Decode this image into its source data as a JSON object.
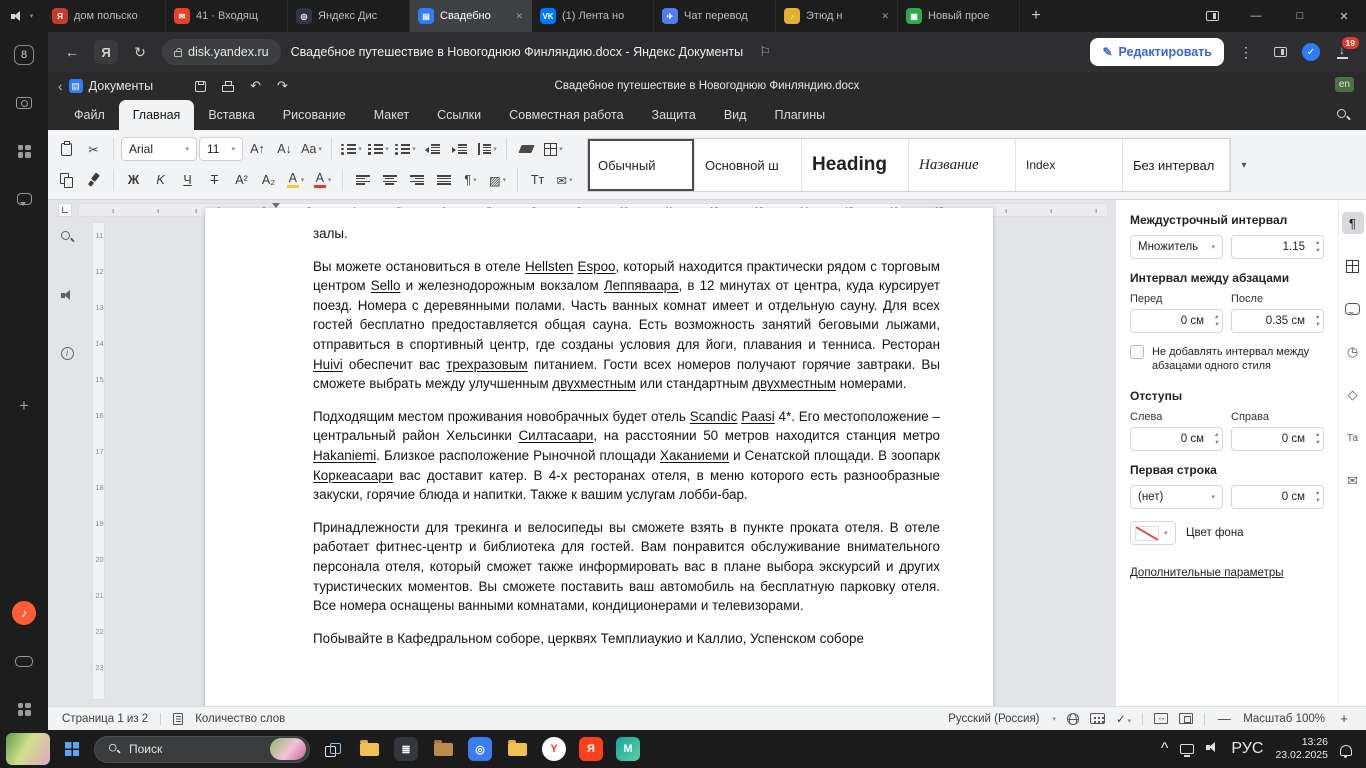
{
  "icons": {
    "chevron_down": "▾",
    "chevron_left": "‹",
    "back": "←",
    "reload": "↻",
    "undo": "↶",
    "redo": "↷",
    "close": "✕",
    "minimize": "—",
    "maximize": "□",
    "plus": "+",
    "scissors": "✂",
    "kebab": "⋮",
    "check": "✓",
    "paragraph": "¶",
    "envelope": "✉",
    "flag": "⚐",
    "pencil": "✎",
    "info": "i",
    "ya": "Я",
    "caret_up": "^",
    "shade": "▨",
    "music": "♪",
    "clock": "◷",
    "shapes": "◇",
    "translate": "Та",
    "down_arrow": "↓",
    "spin_up": "▴",
    "spin_down": "▾",
    "tt": "Тт"
  },
  "browser": {
    "tabs": [
      {
        "label": "дом польско",
        "glyph": "Я",
        "color": "#c43c2e"
      },
      {
        "label": "41 · Входящ",
        "glyph": "✉",
        "color": "#e8402a"
      },
      {
        "label": "Яндекс Дис",
        "glyph": "◎",
        "color": "#2f3640"
      },
      {
        "label": "Свадебно",
        "glyph": "▤",
        "color": "#2f7df6",
        "active": true,
        "close": true
      },
      {
        "label": "(1) Лента но",
        "glyph": "VK",
        "color": "#0077ff"
      },
      {
        "label": "Чат перевод",
        "glyph": "✈",
        "color": "#4f7df0"
      },
      {
        "label": "Этюд н",
        "glyph": "♪",
        "color": "#e9b02c",
        "close": true
      },
      {
        "label": "Новый прое",
        "glyph": "▦",
        "color": "#2fa84f"
      }
    ],
    "address": {
      "domain": "disk.yandex.ru",
      "title": "Свадебное путешествие в Новогоднюю Финляндию.docx - Яндекс Документы",
      "edit_button": "Редактировать",
      "downloads_badge": "19"
    },
    "sidebar": {
      "tabs_count": "8"
    }
  },
  "app": {
    "header": {
      "back_label": "Документы",
      "title": "Свадебное путешествие в Новогоднюю Финляндию.docx",
      "lang_badge": "en"
    },
    "menu": [
      "Файл",
      "Главная",
      "Вставка",
      "Рисование",
      "Макет",
      "Ссылки",
      "Совместная работа",
      "Защита",
      "Вид",
      "Плагины"
    ],
    "active_menu_index": 1,
    "toolbar": {
      "font": "Arial",
      "size": "11",
      "bold": "Ж",
      "italic": "K",
      "underline": "Ч",
      "strike": "Т",
      "superscript": "A²",
      "subscript": "A₂",
      "font_up": "A↑",
      "font_down": "A↓",
      "case": "Aa",
      "color_letter": "А",
      "styles": [
        {
          "label": "Обычный",
          "cls": "normal",
          "selected": true
        },
        {
          "label": "Основной ш",
          "cls": "basic"
        },
        {
          "label": "Heading",
          "cls": "heading"
        },
        {
          "label": "Название",
          "cls": "title"
        },
        {
          "label": "Index",
          "cls": "index"
        },
        {
          "label": "Без интервал",
          "cls": "nospace"
        }
      ]
    }
  },
  "rulers": {
    "h": [
      1,
      2,
      3,
      4,
      5,
      6,
      7,
      8,
      9,
      10,
      11,
      12,
      13,
      14,
      15,
      16,
      17
    ],
    "v": [
      11,
      12,
      13,
      14,
      15,
      16,
      17,
      18,
      19,
      20,
      21,
      22,
      23
    ]
  },
  "document": {
    "paragraphs": [
      {
        "runs": [
          {
            "t": "залы."
          }
        ]
      },
      {
        "runs": [
          {
            "t": "Вы можете остановиться в отеле "
          },
          {
            "t": "Hellsten",
            "u": true
          },
          {
            "t": " "
          },
          {
            "t": "Espoo",
            "u": true
          },
          {
            "t": ", который находится практически рядом с торговым центром "
          },
          {
            "t": "Sello",
            "u": true
          },
          {
            "t": " и железнодорожным вокзалом "
          },
          {
            "t": "Леппяваара",
            "u": true
          },
          {
            "t": ", в 12 минутах от центра, куда курсирует поезд. Номера с деревянными полами. Часть ванных комнат имеет и отдельную сауну. Для всех гостей бесплатно предоставляется общая сауна. Есть возможность занятий беговыми лыжами, отправиться в спортивный центр, где созданы условия для йоги, плавания и тенниса. Ресторан "
          },
          {
            "t": "Huivi",
            "u": true
          },
          {
            "t": " обеспечит вас "
          },
          {
            "t": "трехразовым",
            "u": true
          },
          {
            "t": " питанием. Гости всех номеров получают горячие завтраки. Вы сможете выбрать между улучшенным "
          },
          {
            "t": "двухместным",
            "u": true
          },
          {
            "t": " или стандартным "
          },
          {
            "t": "двухместным",
            "u": true
          },
          {
            "t": " номерами."
          }
        ]
      },
      {
        "runs": [
          {
            "t": "Подходящим местом проживания новобрачных будет отель "
          },
          {
            "t": "Scandic",
            "u": true
          },
          {
            "t": " "
          },
          {
            "t": "Paasi",
            "u": true
          },
          {
            "t": " 4*. Его местоположение – центральный район Хельсинки "
          },
          {
            "t": "Силтасаари",
            "u": true
          },
          {
            "t": ", на расстоянии 50 метров находится станция метро "
          },
          {
            "t": "Hakaniemi",
            "u": true
          },
          {
            "t": ". Близкое расположение Рыночной площади "
          },
          {
            "t": "Хаканиеми",
            "u": true
          },
          {
            "t": " и Сенатской площади. В зоопарк "
          },
          {
            "t": "Коркеасаари",
            "u": true
          },
          {
            "t": " вас доставит катер. В 4-х ресторанах отеля, в меню которого есть разнообразные закуски, горячие блюда и напитки. Также к вашим услугам лобби-бар."
          }
        ]
      },
      {
        "runs": [
          {
            "t": "Принадлежности для трекинга и велосипеды вы сможете взять в пункте проката отеля. В отеле работает фитнес-центр и библиотека для гостей. Вам понравится обслуживание внимательного персонала отеля, который сможет также информировать вас в плане выбора экскурсий и других туристических моментов. Вы сможете поставить ваш автомобиль на бесплатную парковку отеля. Все номера оснащены ванными комнатами, кондиционерами и телевизорами."
          }
        ]
      },
      {
        "runs": [
          {
            "t": "Побывайте в Кафедральном соборе, церквях Темплиаукио и Каллио, Успенском соборе"
          }
        ]
      }
    ]
  },
  "panel": {
    "line_spacing_title": "Междустрочный интервал",
    "multiplier": "Множитель",
    "multiplier_value": "1.15",
    "para_spacing_title": "Интервал между абзацами",
    "before_label": "Перед",
    "after_label": "После",
    "before_value": "0 см",
    "after_value": "0.35 см",
    "no_interval_label": "Не добавлять интервал между абзацами одного стиля",
    "indents_title": "Отступы",
    "left_label": "Слева",
    "right_label": "Справа",
    "left_value": "0 см",
    "right_value": "0 см",
    "first_line_title": "Первая строка",
    "first_line_value": "(нет)",
    "first_line_indent": "0 см",
    "bg_color_label": "Цвет фона",
    "more_link": "Дополнительные параметры"
  },
  "statusbar": {
    "page": "Страница 1 из 2",
    "word_count": "Количество слов",
    "language": "Русский (Россия)",
    "zoom_label": "Масштаб 100%",
    "zoom_out": "—",
    "zoom_in": "+"
  },
  "taskbar": {
    "search_placeholder": "Поиск",
    "lang": "РУС",
    "time": "13:26",
    "date": "23.02.2025"
  }
}
